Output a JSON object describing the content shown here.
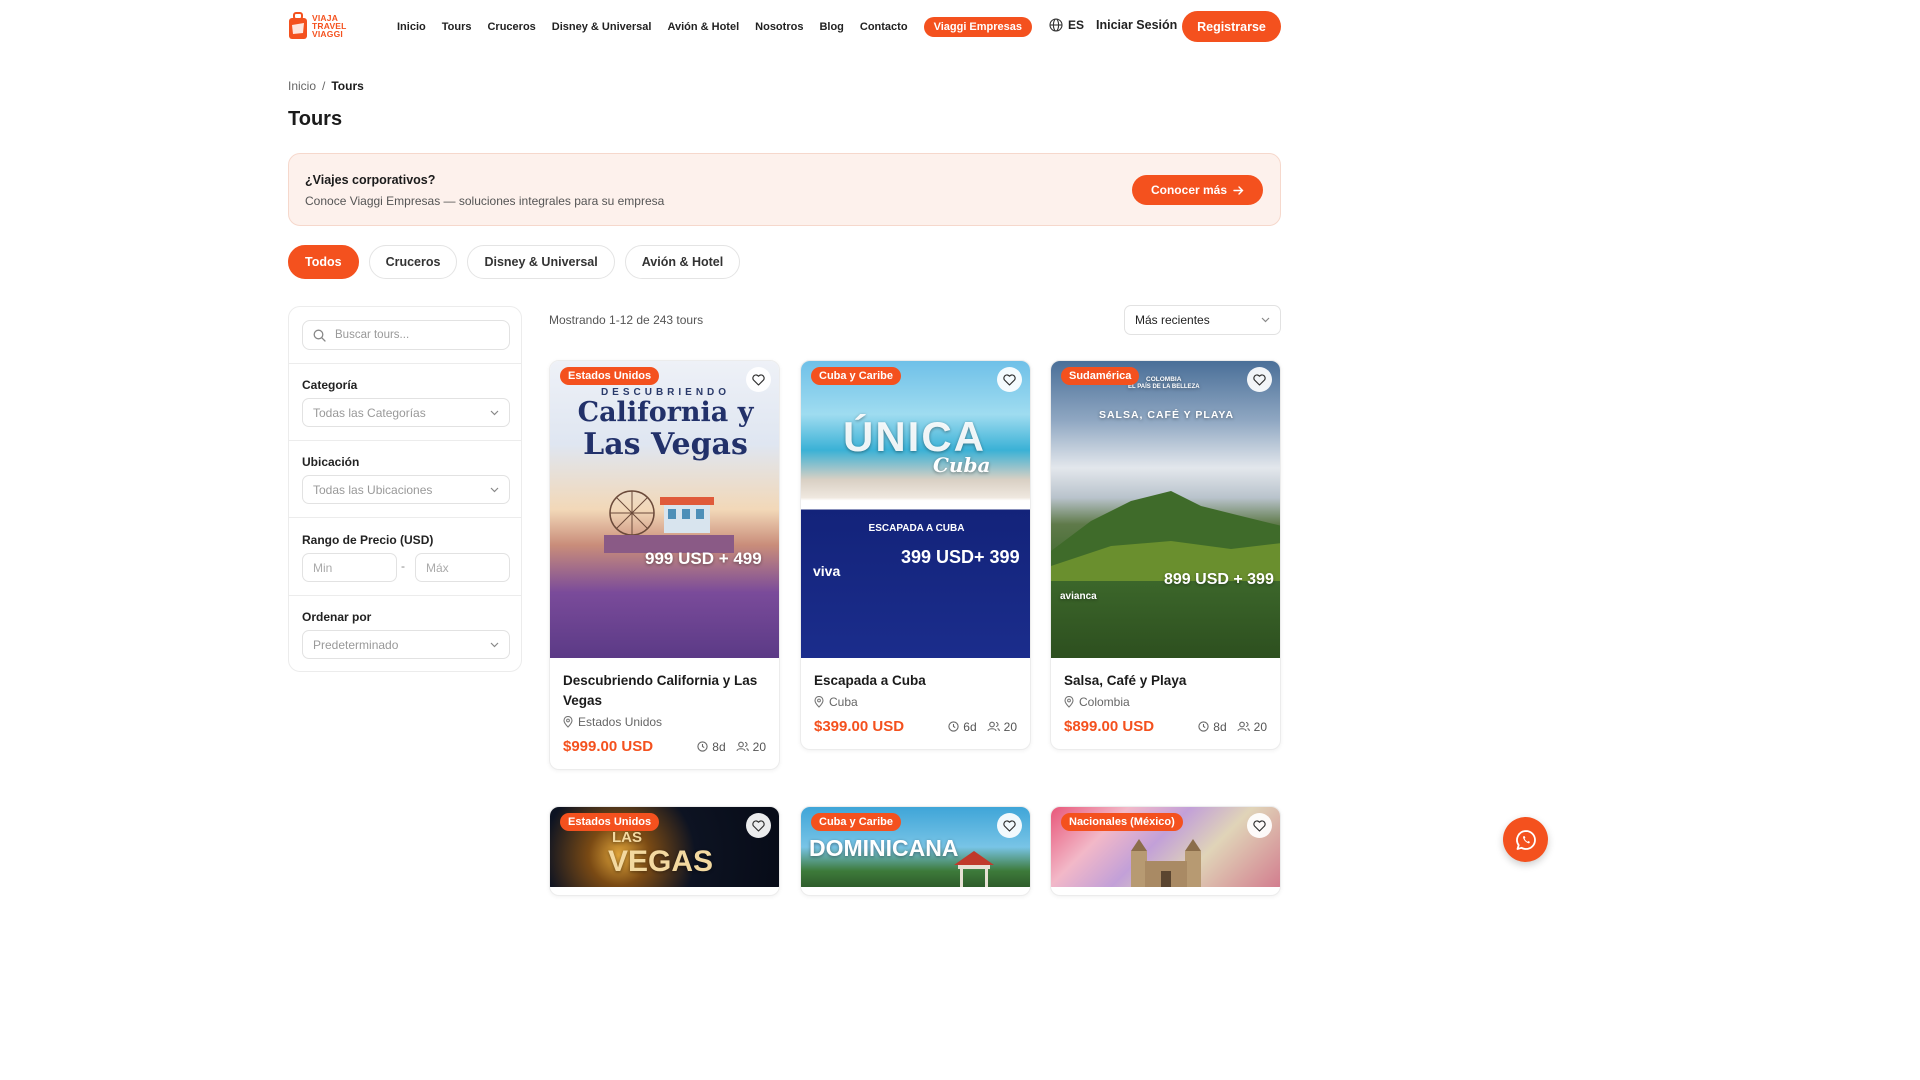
{
  "brand": {
    "line1": "VIAJA",
    "line2": "TRAVEL",
    "line3": "VIAGGI",
    "accent": "#f4511e"
  },
  "nav": {
    "links": [
      "Inicio",
      "Tours",
      "Cruceros",
      "Disney & Universal",
      "Avión & Hotel",
      "Nosotros",
      "Blog",
      "Contacto"
    ],
    "pill": "Viaggi Empresas",
    "lang": "ES",
    "login": "Iniciar Sesión",
    "signup": "Registrarse"
  },
  "breadcrumb": {
    "home": "Inicio",
    "sep": "/",
    "current": "Tours"
  },
  "page_title": "Tours",
  "corp": {
    "title": "¿Viajes corporativos?",
    "subtitle": "Conoce Viaggi Empresas — soluciones integrales para su empresa",
    "button": "Conocer más"
  },
  "tabs": [
    "Todos",
    "Cruceros",
    "Disney & Universal",
    "Avión & Hotel"
  ],
  "filters": {
    "search_placeholder": "Buscar tours...",
    "category_label": "Categoría",
    "category_value": "Todas las Categorías",
    "location_label": "Ubicación",
    "location_value": "Todas las Ubicaciones",
    "price_label": "Rango de Precio (USD)",
    "min_placeholder": "Min",
    "max_placeholder": "Máx",
    "price_sep": "-",
    "order_label": "Ordenar por",
    "order_value": "Predeterminado"
  },
  "results": {
    "showing": "Mostrando 1-12 de 243 tours",
    "sort": "Más recientes"
  },
  "tours": [
    {
      "badge": "Estados Unidos",
      "title": "Descubriendo California y Las Vegas",
      "location": "Estados Unidos",
      "price": "$999.00 USD",
      "days": "8d",
      "people": "20",
      "poster": {
        "top": "DESCUBRIENDO",
        "main": "California y",
        "main2": "Las Vegas",
        "price": "999 USD + 499"
      }
    },
    {
      "badge": "Cuba y Caribe",
      "title": "Escapada a Cuba",
      "location": "Cuba",
      "price": "$399.00 USD",
      "days": "6d",
      "people": "20",
      "poster": {
        "top": "ÚNICA",
        "main": "Cuba",
        "band": "ESCAPADA A CUBA",
        "price": "399 USD+ 399",
        "airline": "viva"
      }
    },
    {
      "badge": "Sudamérica",
      "title": "Salsa, Café y Playa",
      "location": "Colombia",
      "price": "$899.00 USD",
      "days": "8d",
      "people": "20",
      "poster": {
        "top": "COLOMBIA",
        "sub": "EL PAÍS DE LA BELLEZA",
        "main": "SALSA, CAFÉ Y PLAYA",
        "price": "899 USD + 399",
        "airline": "avianca"
      }
    },
    {
      "badge": "Estados Unidos",
      "poster": {
        "main": "LAS",
        "main2": "VEGAS"
      }
    },
    {
      "badge": "Cuba y Caribe",
      "poster": {
        "main": "DOMINICANA"
      }
    },
    {
      "badge": "Nacionales (México)",
      "poster": {
        "main": ""
      }
    }
  ]
}
